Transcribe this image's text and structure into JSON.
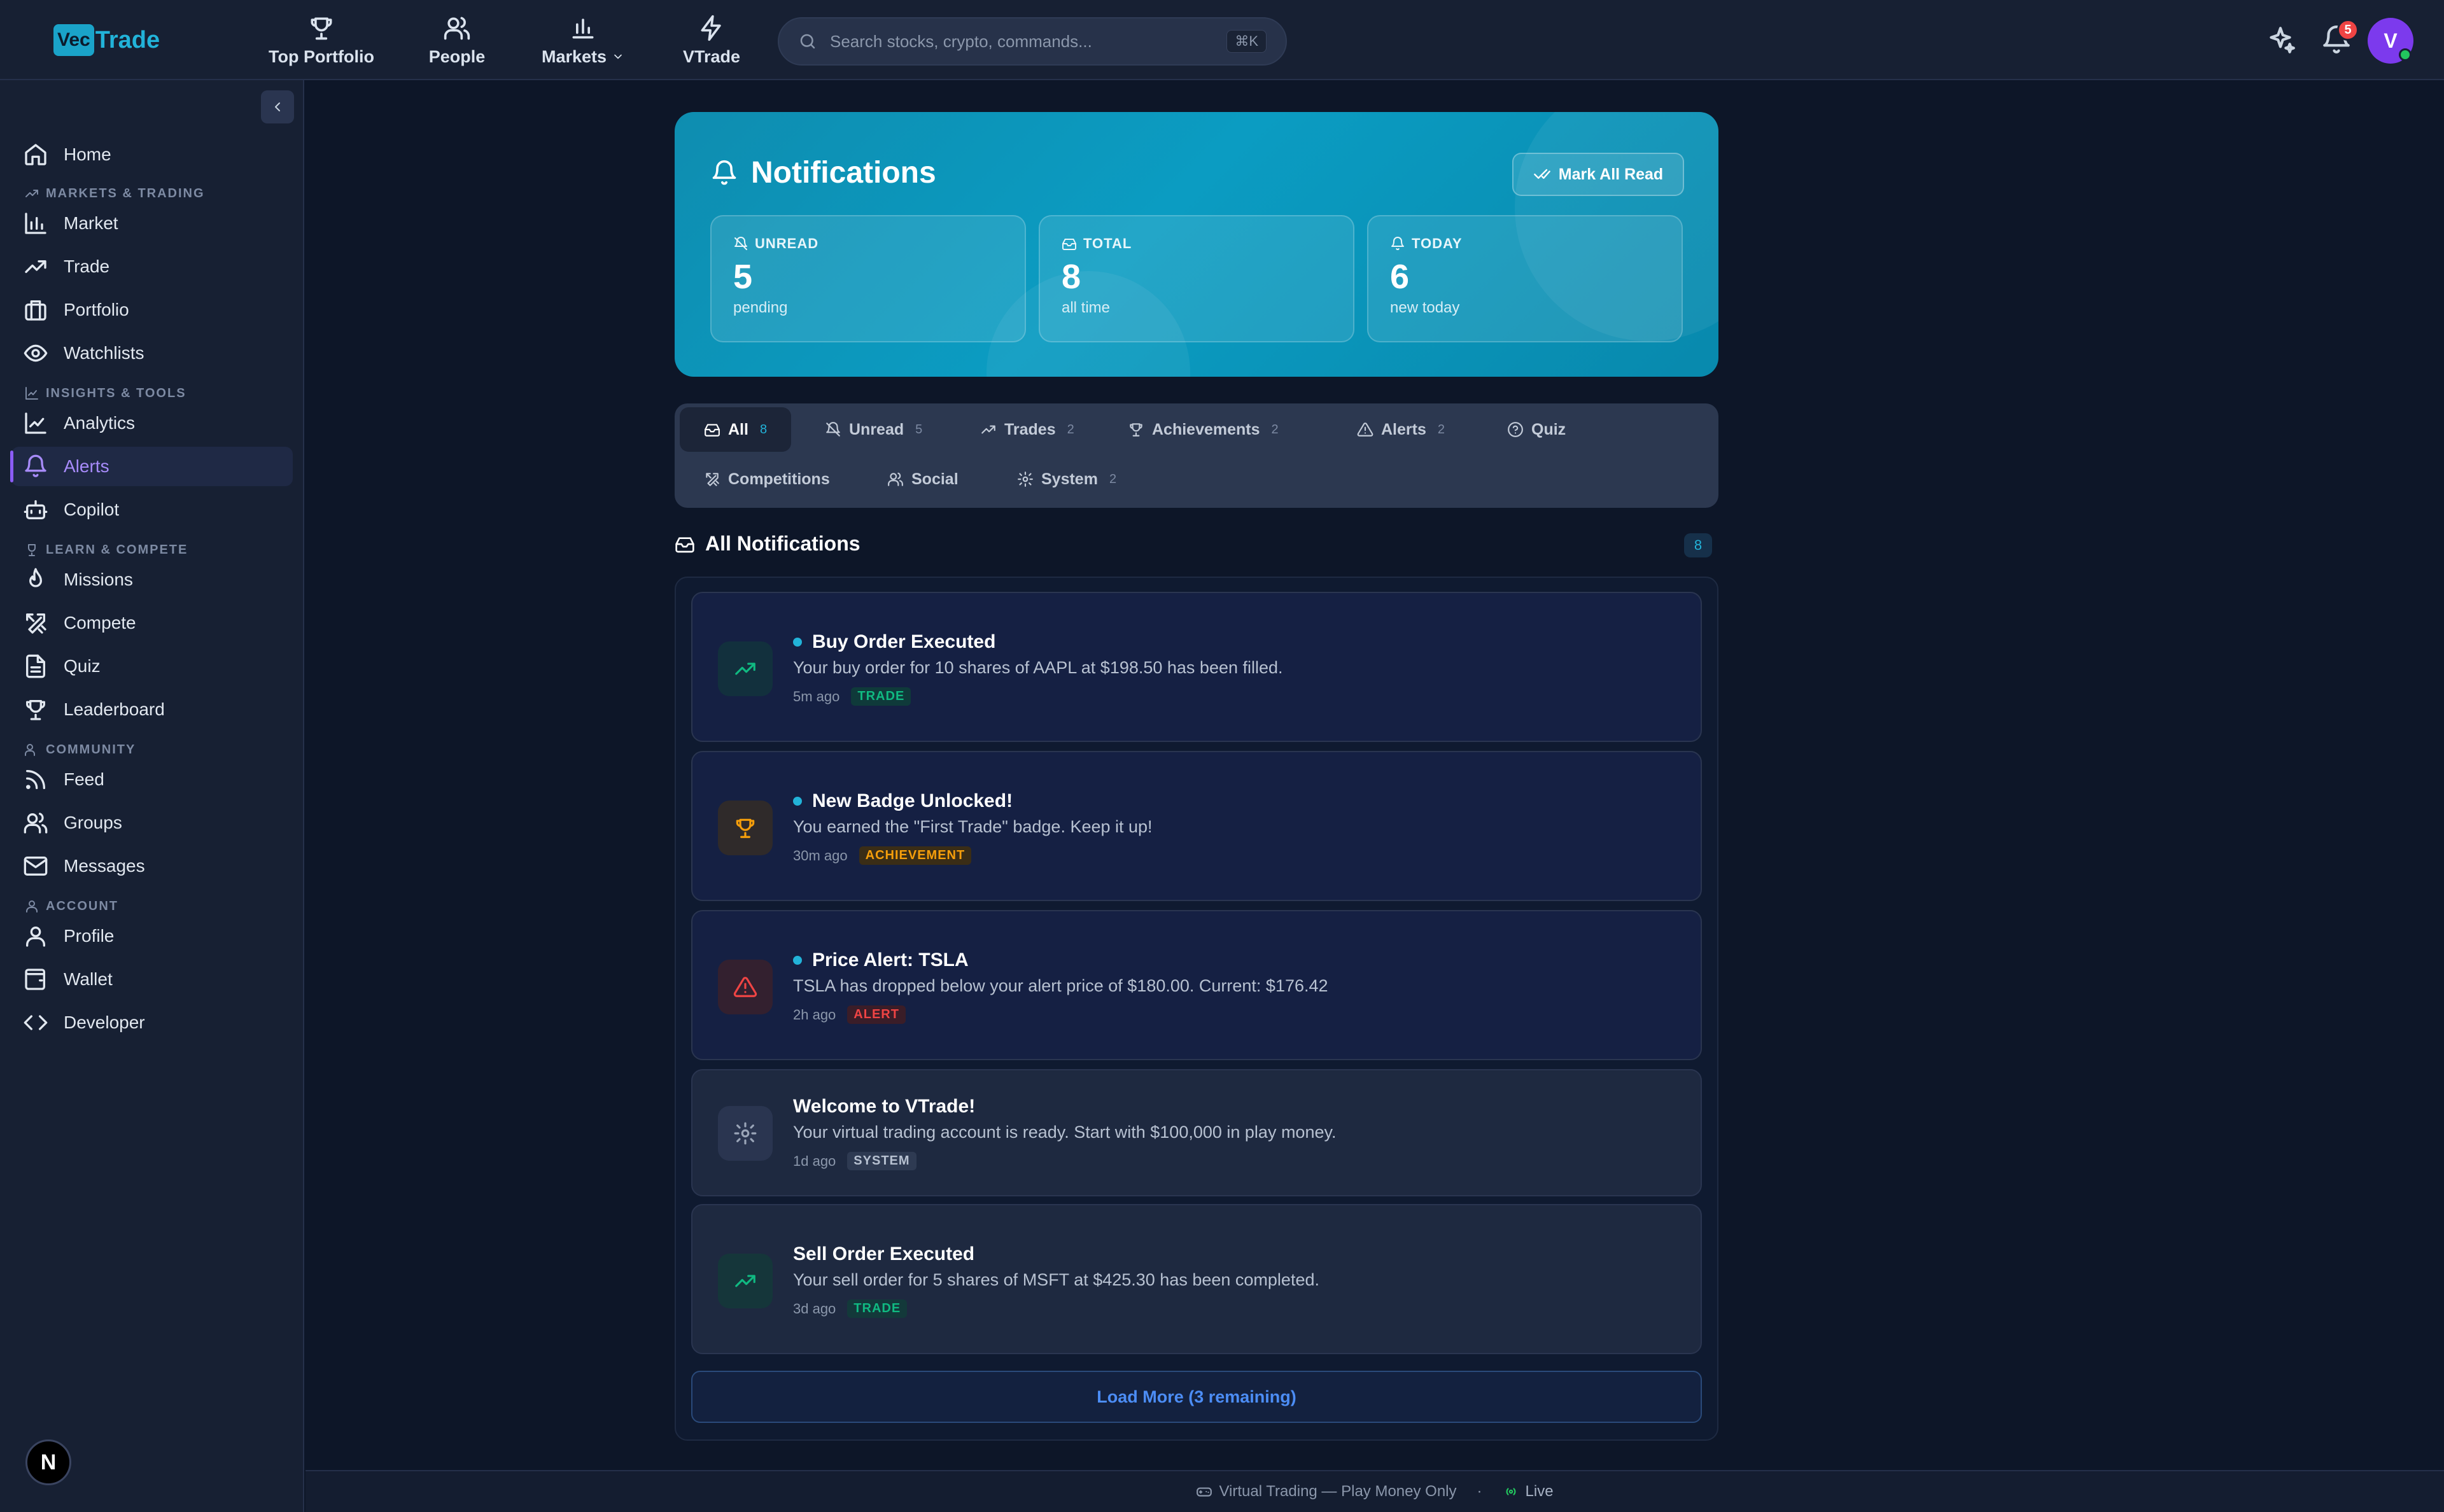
{
  "brand": {
    "logo_box": "Vec",
    "logo_text": "Trade"
  },
  "topnav": [
    {
      "label": "Top Portfolio",
      "icon": "trophy-icon"
    },
    {
      "label": "People",
      "icon": "users-icon"
    },
    {
      "label": "Markets",
      "icon": "bar-chart-icon"
    },
    {
      "label": "VTrade",
      "icon": "zap-icon"
    }
  ],
  "search": {
    "placeholder": "Search stocks, crypto, commands...",
    "shortcut": "⌘K"
  },
  "header": {
    "notification_count": "5",
    "avatar_initial": "V"
  },
  "sidebar": {
    "home": "Home",
    "sections": {
      "markets": "MARKETS & TRADING",
      "insights": "INSIGHTS & TOOLS",
      "learn": "LEARN & COMPETE",
      "community": "COMMUNITY",
      "account": "ACCOUNT"
    },
    "items": {
      "market": "Market",
      "trade": "Trade",
      "portfolio": "Portfolio",
      "watchlists": "Watchlists",
      "analytics": "Analytics",
      "alerts": "Alerts",
      "copilot": "Copilot",
      "missions": "Missions",
      "compete": "Compete",
      "quiz": "Quiz",
      "leaderboard": "Leaderboard",
      "feed": "Feed",
      "groups": "Groups",
      "messages": "Messages",
      "profile": "Profile",
      "wallet": "Wallet",
      "developer": "Developer"
    },
    "n_badge": "N"
  },
  "hero": {
    "title": "Notifications",
    "mark_all": "Mark All Read",
    "stats": [
      {
        "label": "UNREAD",
        "value": "5",
        "sub": "pending"
      },
      {
        "label": "TOTAL",
        "value": "8",
        "sub": "all time"
      },
      {
        "label": "TODAY",
        "value": "6",
        "sub": "new today"
      }
    ]
  },
  "filters": [
    {
      "label": "All",
      "count": "8"
    },
    {
      "label": "Unread",
      "count": "5"
    },
    {
      "label": "Trades",
      "count": "2"
    },
    {
      "label": "Achievements",
      "count": "2"
    },
    {
      "label": "Alerts",
      "count": "2"
    },
    {
      "label": "Quiz",
      "count": ""
    },
    {
      "label": "Competitions",
      "count": ""
    },
    {
      "label": "Social",
      "count": ""
    },
    {
      "label": "System",
      "count": "2"
    }
  ],
  "list": {
    "title": "All Notifications",
    "count": "8",
    "items": [
      {
        "title": "Buy Order Executed",
        "body": "Your buy order for 10 shares of AAPL at $198.50 has been filled.",
        "time": "5m ago",
        "tag": "TRADE"
      },
      {
        "title": "New Badge Unlocked!",
        "body": "You earned the \"First Trade\" badge. Keep it up!",
        "time": "30m ago",
        "tag": "ACHIEVEMENT"
      },
      {
        "title": "Price Alert: TSLA",
        "body": "TSLA has dropped below your alert price of $180.00. Current: $176.42",
        "time": "2h ago",
        "tag": "ALERT"
      },
      {
        "title": "Welcome to VTrade!",
        "body": "Your virtual trading account is ready. Start with $100,000 in play money.",
        "time": "1d ago",
        "tag": "SYSTEM"
      },
      {
        "title": "Sell Order Executed",
        "body": "Your sell order for 5 shares of MSFT at $425.30 has been completed.",
        "time": "3d ago",
        "tag": "TRADE"
      }
    ],
    "load_more": "Load More (3 remaining)"
  },
  "footer": {
    "text": "Virtual Trading — Play Money Only",
    "separator": "·",
    "live": "Live"
  },
  "colors": {
    "accent": "#22b3d9",
    "trade": "#10b981",
    "achievement": "#f59e0b",
    "alert": "#ef4444",
    "active_nav": "#8b5cf6"
  }
}
